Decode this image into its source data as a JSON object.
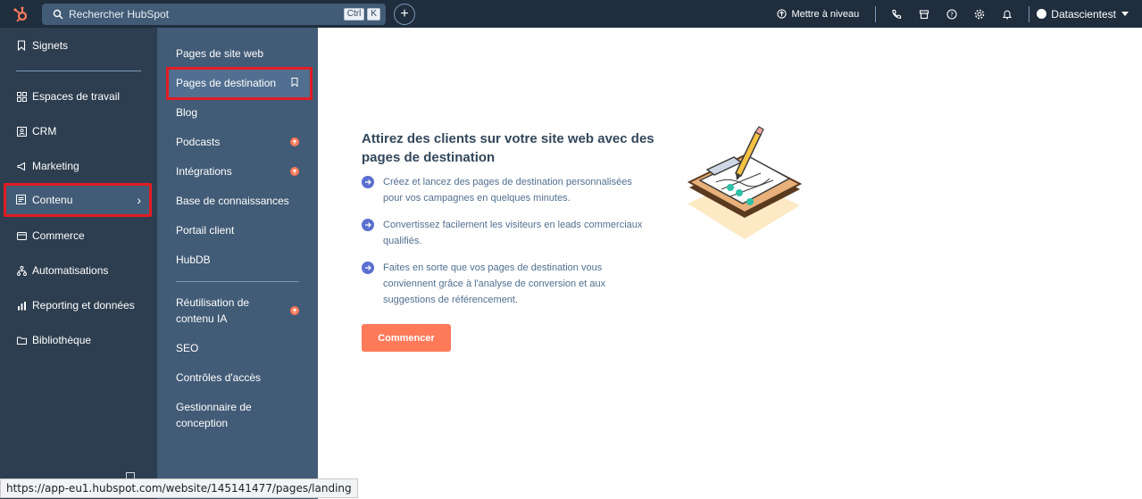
{
  "topbar": {
    "search_placeholder": "Rechercher HubSpot",
    "shortcut_key1": "Ctrl",
    "shortcut_key2": "K",
    "plus_label": "+",
    "upgrade_label": "Mettre à niveau",
    "account_name": "Datascientest"
  },
  "sidebar": {
    "bookmarks": "Signets",
    "items": [
      {
        "label": "Espaces de travail",
        "icon": "grid-icon"
      },
      {
        "label": "CRM",
        "icon": "contact-card-icon"
      },
      {
        "label": "Marketing",
        "icon": "megaphone-icon"
      },
      {
        "label": "Contenu",
        "icon": "content-icon"
      },
      {
        "label": "Commerce",
        "icon": "storefront-icon"
      },
      {
        "label": "Automatisations",
        "icon": "workflow-icon"
      },
      {
        "label": "Reporting et données",
        "icon": "bar-chart-icon"
      },
      {
        "label": "Bibliothèque",
        "icon": "folder-icon"
      }
    ],
    "active_chevron": "›"
  },
  "submenu": {
    "items": [
      {
        "label": "Pages de site web"
      },
      {
        "label": "Pages de destination"
      },
      {
        "label": "Blog"
      },
      {
        "label": "Podcasts"
      },
      {
        "label": "Intégrations"
      },
      {
        "label": "Base de connaissances"
      },
      {
        "label": "Portail client"
      },
      {
        "label": "HubDB"
      },
      {
        "label": "Réutilisation de contenu IA"
      },
      {
        "label": "SEO"
      },
      {
        "label": "Contrôles d'accès"
      },
      {
        "label": "Gestionnaire de conception"
      }
    ]
  },
  "main": {
    "title": "Attirez des clients sur votre site web avec des pages de destination",
    "bullets": [
      "Créez et lancez des pages de destination personnalisées pour vos campagnes en quelques minutes.",
      "Convertissez facilement les visiteurs en leads commerciaux qualifiés.",
      "Faites en sorte que vos pages de destination vous conviennent grâce à l'analyse de conversion et aux suggestions de référencement."
    ],
    "cta_label": "Commencer"
  },
  "statusbar": {
    "url": "https://app-eu1.hubspot.com/website/145141477/pages/landing"
  },
  "colors": {
    "topbar_bg": "#1f2d3d",
    "sidebar_bg": "#2d3e50",
    "submenu_bg": "#425b76",
    "accent_orange": "#ff7a59",
    "highlight_red": "#e11d24",
    "bullet_icon": "#5a6fcf"
  }
}
